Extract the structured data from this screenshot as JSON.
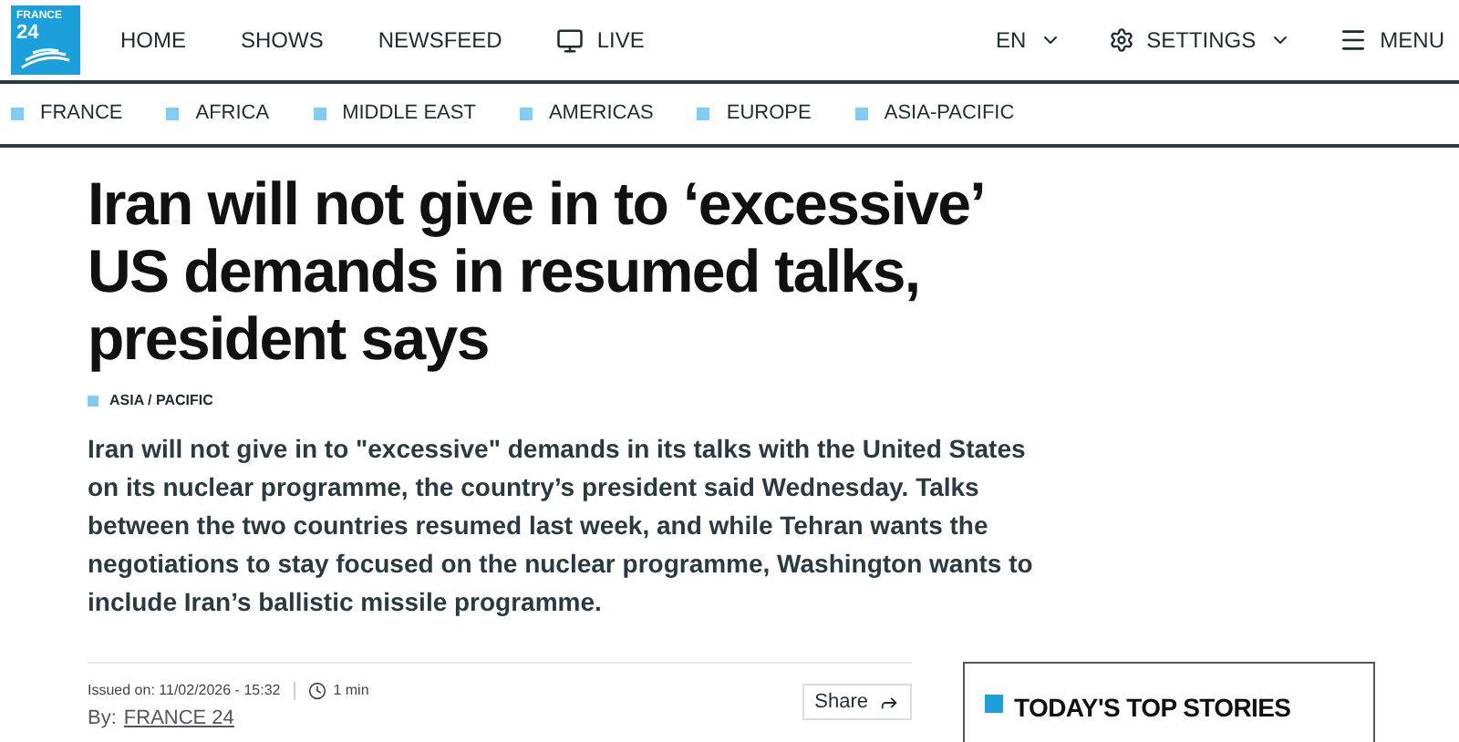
{
  "logo": {
    "line_1": "FRANCE",
    "line_2": "24"
  },
  "nav": [
    {
      "label": "HOME",
      "kind": "text"
    },
    {
      "label": "SHOWS",
      "kind": "text"
    },
    {
      "label": "NEWSFEED",
      "kind": "text"
    },
    {
      "label": "LIVE",
      "kind": "live"
    }
  ],
  "language": {
    "label": "EN"
  },
  "settings": {
    "label": "SETTINGS"
  },
  "menu": {
    "label": "MENU"
  },
  "regions": [
    {
      "label": "FRANCE",
      "color": "#7fcdf7"
    },
    {
      "label": "AFRICA",
      "color": "#7fcdf7"
    },
    {
      "label": "MIDDLE EAST",
      "color": "#7fcdf7"
    },
    {
      "label": "AMERICAS",
      "color": "#7fcdf7"
    },
    {
      "label": "EUROPE",
      "color": "#7fcdf7"
    },
    {
      "label": "ASIA-PACIFIC",
      "color": "#7fcdf7"
    }
  ],
  "article": {
    "title": "Iran will not give in to ‘excessive’ US demands in resumed talks, president says",
    "tag": {
      "label": "ASIA / PACIFIC",
      "color": "#7fcdf7"
    },
    "summary": "Iran will not give in to \"excessive\" demands in its talks with the United States on its nuclear programme, the country’s president said Wednesday. Talks between the two countries resumed last week, and while Tehran wants the negotiations to stay focused on the nuclear programme, Washington wants to include Iran’s ballistic missile programme.",
    "issued": "Issued on: 11/02/2026 - 15:32",
    "read_time": "1 min",
    "byline_prefix": "By:",
    "author": "FRANCE 24",
    "share": "Share"
  },
  "top_stories": {
    "title": "TODAY'S TOP STORIES"
  }
}
